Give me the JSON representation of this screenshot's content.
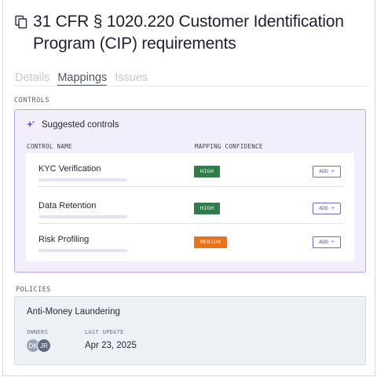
{
  "header": {
    "title": "31 CFR § 1020.220 Customer Identification Program (CIP) requirements",
    "icon": "copy-icon"
  },
  "tabs": [
    {
      "label": "Details",
      "active": false
    },
    {
      "label": "Mappings",
      "active": true
    },
    {
      "label": "Issues",
      "active": false
    }
  ],
  "controls": {
    "section_label": "CONTROLS",
    "suggested_label": "Suggested controls",
    "suggested_icon": "sparkle-icon",
    "col_name": "CONTROL NAME",
    "col_confidence": "MAPPING CONFIDENCE",
    "rows": [
      {
        "name": "KYC Verification",
        "confidence": "HIGH",
        "confidence_color": "#2f7d4a",
        "action": "ADD +"
      },
      {
        "name": "Data Retention",
        "confidence": "HIGH",
        "confidence_color": "#2f7d4a",
        "action": "ADD +"
      },
      {
        "name": "Risk Profiling",
        "confidence": "MEDIUM",
        "confidence_color": "#e8731a",
        "action": "ADD +"
      }
    ]
  },
  "policies": {
    "section_label": "POLICIES",
    "name": "Anti-Money Laundering",
    "owners_label": "OWNERS",
    "last_update_label": "LAST UPDATE",
    "owners": [
      {
        "initials": "DK",
        "color": "#9aa4b8"
      },
      {
        "initials": "JR",
        "color": "#5f6b80"
      }
    ],
    "last_update": "Apr 23, 2025"
  },
  "colors": {
    "accent": "#7c63c9",
    "suggested_bg": "#f2eefb",
    "policies_bg": "#edf1f6"
  }
}
